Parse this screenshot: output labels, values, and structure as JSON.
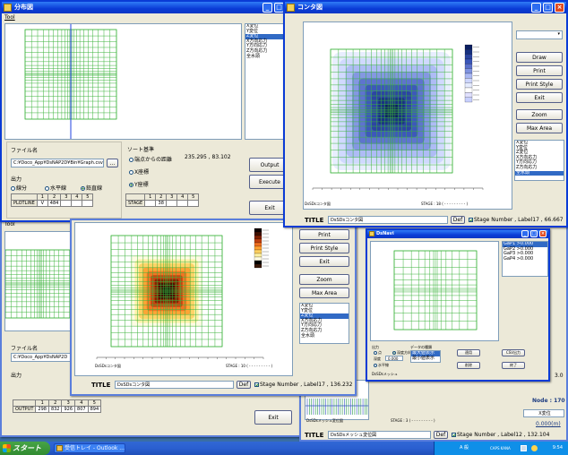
{
  "win_main": {
    "title": "分布図",
    "menu_tool": "Tool",
    "list_items": [
      "X変位",
      "Y変位",
      "Z変位",
      "X方向応力",
      "Y方向応力",
      "Z方向応力",
      "全水頭"
    ],
    "list_selected": 2,
    "file_label": "ファイル名",
    "file_path": "C:¥Doco_App¥DsNAP2D¥Bin¥Graph.csv",
    "browse_label": "...",
    "output_group": "出力",
    "radio_line": "線分",
    "radio_horizontal": "水平線",
    "radio_vertical": "鉛直線",
    "sort_label": "ソート基準",
    "sort_opt1": "端点からの距離",
    "sort_opt2": "X座標",
    "sort_opt3": "Y座標",
    "coord_readout": "235.295 , 83.102",
    "output_button": "Output",
    "execute_button": "Execute",
    "exit_button": "Exit",
    "ptable_headers": [
      "",
      "1",
      "2",
      "3",
      "4",
      "5"
    ],
    "ptable_row_label": "PLOTLINE",
    "ptable_row": [
      "V",
      "484",
      "",
      "",
      ""
    ],
    "stable_headers": [
      "",
      "1",
      "2",
      "3",
      "4",
      "5"
    ],
    "stable_row_label": "STAGE",
    "stable_row": [
      "",
      "38",
      "",
      "",
      ""
    ]
  },
  "win_contour_top": {
    "title": "コンタ図",
    "draw_button": "Draw",
    "print_button": "Print",
    "print_style_button": "Print Style",
    "exit_button": "Exit",
    "zoom_button": "Zoom",
    "max_area_button": "Max Area",
    "list_items": [
      "X変位",
      "Y変位",
      "Z変位",
      "X方向応力",
      "Y方向応力",
      "Z方向応力",
      "全水頭"
    ],
    "list_selected": 6,
    "plot_title": "DsSDsコンタ図",
    "stage_text": "STAGE : 18 ( - - - - - - - - - )",
    "title_label": "TITLE",
    "title_value": "DsSDsコンタ図",
    "def_button": "Def",
    "stage_check": "Stage Number , Label17 , 66.667"
  },
  "win_contour_mid": {
    "print_button": "Print",
    "print_style_button": "Print Style",
    "exit_button": "Exit",
    "zoom_button": "Zoom",
    "max_area_button": "Max Area",
    "list_items": [
      "X変位",
      "Y変位",
      "Z変位",
      "X方向応力",
      "Y方向応力",
      "Z方向応力",
      "全水頭"
    ],
    "list_selected": 2,
    "plot_title": "DsSDsコンタ図",
    "stage_text": "STAGE : 10 ( - - - - - - - - - )",
    "title_label": "TITLE",
    "title_value": "DsSDsコンタ図",
    "def_button": "Def",
    "stage_check": "Stage Number , Label17 , 136.232"
  },
  "win_back": {
    "menu_tool": "Tool",
    "file_label": "ファイル名",
    "file_path": "C:¥Doco_App¥DsNAP2D",
    "output_group": "出力",
    "table_headers": [
      "",
      "1",
      "2",
      "3",
      "4",
      "5"
    ],
    "table_row_label": "OUTPUT",
    "table_row": [
      "298",
      "832",
      "926",
      "807",
      "894"
    ],
    "exit_button": "Exit"
  },
  "win_mesh": {
    "title_label": "TITLE",
    "title_value": "DsSDsメッシュ変位図",
    "def_button": "Def",
    "stage_check": "Stage Number , Label12 , 132.104",
    "node_label": "Node : 170",
    "direction_value": "X変位",
    "scale_value": "0.000(m)",
    "stage_text": "STAGE : 3 ( - - - - - - - - - )",
    "plot_title": "DsSDsメッシュ変位図",
    "right_value": "3.0"
  },
  "win_small": {
    "title": "DsNavi",
    "list_items": [
      "GaP1 >0.000",
      "GaP2 >0.000",
      "GaP3 >0.000",
      "GaP4 >0.000"
    ],
    "output_group": "出力",
    "radio_point": "点",
    "radio_vertical": "深度方向",
    "radio_horizontal": "水平線",
    "depth_label": "深度",
    "depth_value": "0.000",
    "dir_label": "データの種類",
    "dir_items": [
      "最大値表示",
      "最小値表示"
    ],
    "apply_button": "適用",
    "delete_button": "削除",
    "csv_button": "CSV出力",
    "exit_button": "終了",
    "footer_text": "DsSDsメッシュ"
  },
  "taskbar": {
    "start_label": "スタート",
    "task_item": "受信トレイ - Outlook ...",
    "tray_ime": "A 般",
    "tray_caps": "CAPS KANA",
    "tray_clock": "9:54"
  },
  "colors": {
    "mesh": "#3cb33c",
    "titlebar": "#0a3bd6",
    "selection": "#316ac5"
  }
}
